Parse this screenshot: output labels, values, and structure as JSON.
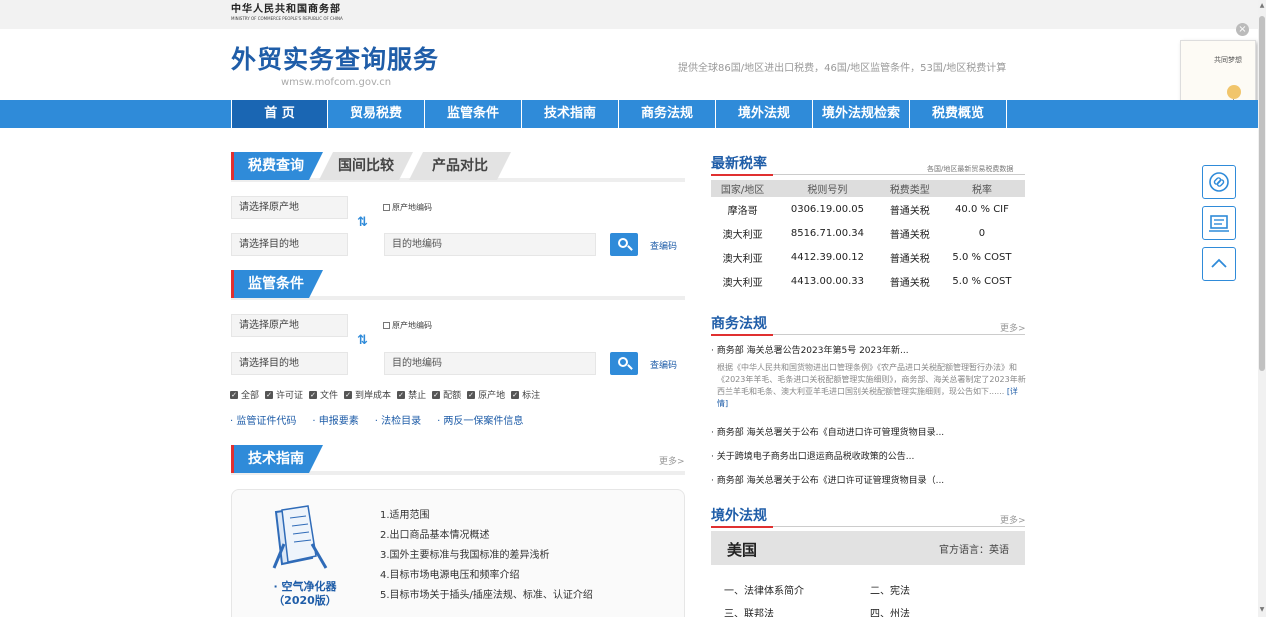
{
  "header": {
    "ministry_cn": "中华人民共和国商务部",
    "ministry_en": "MINISTRY OF COMMERCE PEOPLE'S REPUBLIC OF CHINA",
    "site_title": "外贸实务查询服务",
    "site_url": "wmsw.mofcom.gov.cn",
    "tagline": "提供全球86国/地区进出口税费，46国/地区监管条件，53国/地区税费计算",
    "close_label": "×",
    "ad_book_title": "共同梦想"
  },
  "nav": [
    "首 页",
    "贸易税费",
    "监管条件",
    "技术指南",
    "商务法规",
    "境外法规",
    "境外法规检索",
    "税费概览"
  ],
  "tax_query": {
    "tab_active": "税费查询",
    "tab_2": "国间比较",
    "tab_3": "产品对比",
    "origin_select": "请选择原产地",
    "dest_select": "请选择目的地",
    "origin_code_label": "原产地编码",
    "dest_code_placeholder": "目的地编码",
    "code_link": "查编码",
    "swap": "⇅"
  },
  "regulation": {
    "title": "监管条件",
    "origin_select": "请选择原产地",
    "dest_select": "请选择目的地",
    "origin_code_label": "原产地编码",
    "dest_code_placeholder": "目的地编码",
    "code_link": "查编码",
    "checks": [
      "全部",
      "许可证",
      "文件",
      "到岸成本",
      "禁止",
      "配额",
      "原产地",
      "标注"
    ],
    "check_mark": "✓",
    "links": [
      "· 监管证件代码",
      "· 申报要素",
      "· 法检目录",
      "· 两反一保案件信息"
    ]
  },
  "tech_guide": {
    "title": "技术指南",
    "more": "更多>",
    "product_name": "· 空气净化器",
    "product_year": "（2020版）",
    "items": [
      "1.适用范围",
      "2.出口商品基本情况概述",
      "3.国外主要标准与我国标准的差异浅析",
      "4.目标市场电源电压和频率介绍",
      "5.目标市场关于插头/插座法规、标准、认证介绍"
    ]
  },
  "rates": {
    "title": "最新税率",
    "note": "各国/地区最新贸易税费数据",
    "columns": [
      "国家/地区",
      "税则号列",
      "税费类型",
      "税率"
    ],
    "rows": [
      [
        "摩洛哥",
        "0306.19.00.05",
        "普通关税",
        "40.0 % CIF"
      ],
      [
        "澳大利亚",
        "8516.71.00.34",
        "普通关税",
        "0"
      ],
      [
        "澳大利亚",
        "4412.39.00.12",
        "普通关税",
        "5.0 % COST"
      ],
      [
        "澳大利亚",
        "4413.00.00.33",
        "普通关税",
        "5.0 % COST"
      ]
    ]
  },
  "commerce_law": {
    "title": "商务法规",
    "more": "更多>",
    "headline": "· 商务部 海关总署公告2023年第5号 2023年新...",
    "summary": "根据《中华人民共和国货物进出口管理条例》《农产品进口关税配额管理暂行办法》和《2023年羊毛、毛条进口关税配额管理实施细则》，商务部、海关总署制定了2023年新西兰羊毛和毛条、澳大利亚羊毛进口国别关税配额管理实施细则，现公告如下......",
    "detail": "[详情]",
    "items": [
      "· 商务部 海关总署关于公布《自动进口许可管理货物目录...",
      "· 关于跨境电子商务出口退运商品税收政策的公告...",
      "· 商务部 海关总署关于公布《进口许可证管理货物目录（..."
    ]
  },
  "overseas_law": {
    "title": "境外法规",
    "more": "更多>",
    "country": "美国",
    "language": "官方语言：英语",
    "laws": [
      "一、法律体系简介",
      "二、宪法",
      "三、联邦法",
      "四、州法"
    ]
  },
  "side_buttons": [
    "link-icon",
    "message-icon",
    "up-icon"
  ],
  "colors": {
    "brand_blue": "#2f8bd9",
    "title_blue": "#1f5da8",
    "accent_red": "#e03030"
  }
}
